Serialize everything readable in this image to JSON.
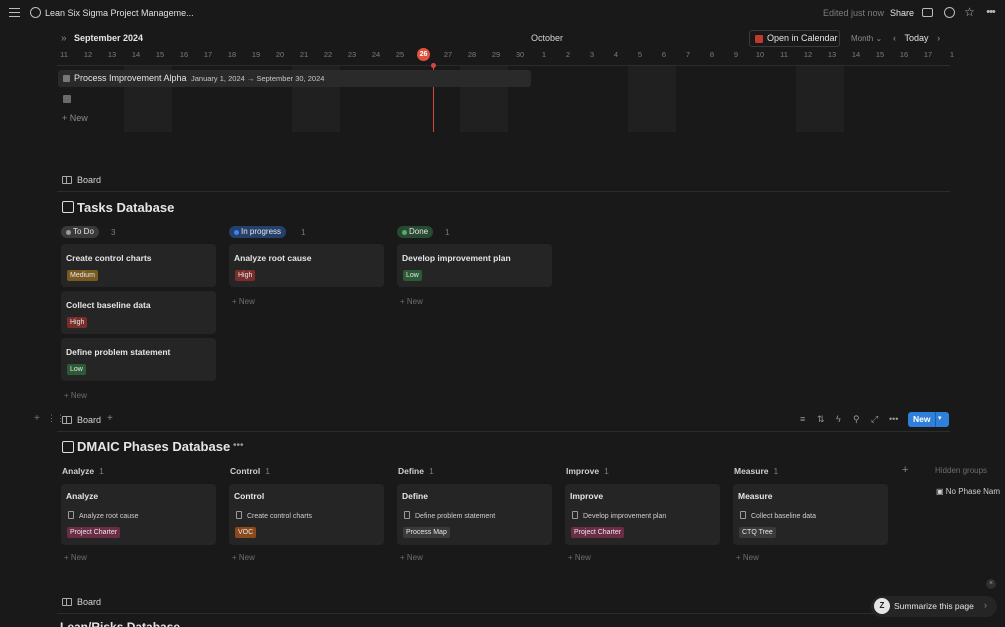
{
  "topbar": {
    "title": "Lean Six Sigma Project Manageme...",
    "edited": "Edited just now",
    "share": "Share"
  },
  "timeline": {
    "month_left": "September 2024",
    "month_mid": "October",
    "open_calendar": "Open in Calendar",
    "view": "Month",
    "today": "Today",
    "days": [
      "11",
      "12",
      "13",
      "14",
      "15",
      "16",
      "17",
      "18",
      "19",
      "20",
      "21",
      "22",
      "23",
      "24",
      "25",
      "26",
      "27",
      "28",
      "29",
      "30",
      "1",
      "2",
      "3",
      "4",
      "5",
      "6",
      "7",
      "8",
      "9",
      "10",
      "11",
      "12",
      "13",
      "14",
      "15",
      "16",
      "17",
      "1"
    ],
    "today_index": 15,
    "item_title": "Process Improvement Alpha",
    "item_dates": "January 1, 2024 → September 30, 2024",
    "new_label": "New"
  },
  "tasks": {
    "tab": "Board",
    "title": "Tasks Database",
    "columns": [
      {
        "status": "To Do",
        "count": "3",
        "dot": "#9b9b9b",
        "bg": "#3a3a3a",
        "cards": [
          {
            "title": "Create control charts",
            "tag": "Medium",
            "tag_bg": "#7a5a23"
          },
          {
            "title": "Collect baseline data",
            "tag": "High",
            "tag_bg": "#7a2e2a"
          },
          {
            "title": "Define problem statement",
            "tag": "Low",
            "tag_bg": "#2c5a36"
          }
        ]
      },
      {
        "status": "In progress",
        "count": "1",
        "dot": "#3b82f6",
        "bg": "#25406a",
        "cards": [
          {
            "title": "Analyze root cause",
            "tag": "High",
            "tag_bg": "#7a2e2a"
          }
        ]
      },
      {
        "status": "Done",
        "count": "1",
        "dot": "#4fb06a",
        "bg": "#284a33",
        "cards": [
          {
            "title": "Develop improvement plan",
            "tag": "Low",
            "tag_bg": "#2c5a36"
          }
        ]
      }
    ],
    "new_label": "New"
  },
  "dmaic": {
    "tab": "Board",
    "title": "DMAIC Phases Database",
    "new_button": "New",
    "hidden_groups": "Hidden groups",
    "no_phase": "No Phase Nam",
    "groups": [
      {
        "name": "Analyze",
        "count": "1",
        "card_title": "Analyze",
        "task": "Analyze root cause",
        "tag": "Project Charter",
        "tag_bg": "#6b2d45"
      },
      {
        "name": "Control",
        "count": "1",
        "card_title": "Control",
        "task": "Create control charts",
        "tag": "VOC",
        "tag_bg": "#8a4a1c"
      },
      {
        "name": "Define",
        "count": "1",
        "card_title": "Define",
        "task": "Define problem statement",
        "tag": "Process Map",
        "tag_bg": "#3a3a3a"
      },
      {
        "name": "Improve",
        "count": "1",
        "card_title": "Improve",
        "task": "Develop improvement plan",
        "tag": "Project Charter",
        "tag_bg": "#6b2d45"
      },
      {
        "name": "Measure",
        "count": "1",
        "card_title": "Measure",
        "task": "Collect baseline data",
        "tag": "CTQ Tree",
        "tag_bg": "#3a3a3a"
      }
    ],
    "new_label": "New"
  },
  "third_board": {
    "tab": "Board",
    "peek_title": "Lean/Risks Database"
  },
  "summarize": {
    "label": "Summarize this page"
  }
}
